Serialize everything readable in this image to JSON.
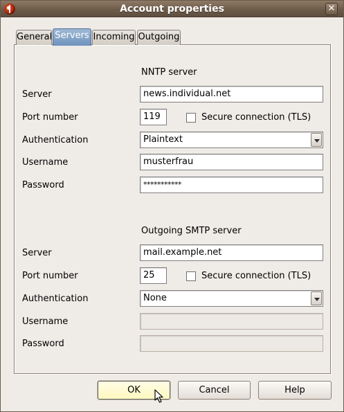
{
  "window": {
    "title": "Account properties",
    "close_symbol": "✕"
  },
  "tabs": [
    {
      "label": "General",
      "active": false
    },
    {
      "label": "Servers",
      "active": true
    },
    {
      "label": "Incoming",
      "active": false
    },
    {
      "label": "Outgoing",
      "active": false
    }
  ],
  "nntp": {
    "section_title": "NNTP server",
    "server_label": "Server",
    "server_value": "news.individual.net",
    "port_label": "Port number",
    "port_value": "119",
    "tls_label": "Secure connection (TLS)",
    "tls_checked": false,
    "auth_label": "Authentication",
    "auth_value": "Plaintext",
    "username_label": "Username",
    "username_value": "musterfrau",
    "password_label": "Password",
    "password_value": "***********"
  },
  "smtp": {
    "section_title": "Outgoing SMTP server",
    "server_label": "Server",
    "server_value": "mail.example.net",
    "port_label": "Port number",
    "port_value": "25",
    "tls_label": "Secure connection (TLS)",
    "tls_checked": false,
    "auth_label": "Authentication",
    "auth_value": "None",
    "username_label": "Username",
    "username_value": "",
    "password_label": "Password",
    "password_value": ""
  },
  "buttons": {
    "ok": "OK",
    "cancel": "Cancel",
    "help": "Help"
  },
  "icons": {
    "app": "app-logo-icon",
    "close": "close-icon",
    "dropdown": "chevron-down-icon",
    "cursor": "mouse-pointer-icon"
  }
}
